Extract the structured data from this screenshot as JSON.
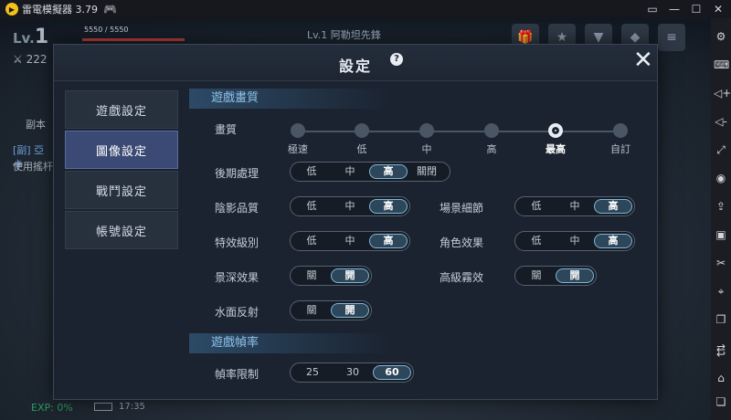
{
  "emulator": {
    "title": "雷電模擬器 3.79",
    "window_controls": [
      "▭",
      "—",
      "☐",
      "✕"
    ],
    "sidebar_tools": [
      "gear-icon",
      "keyboard-icon",
      "volume-up-icon",
      "volume-down-icon",
      "fullscreen-icon",
      "record-icon",
      "install-apk-icon",
      "screenshot-icon",
      "scissors-icon",
      "location-icon",
      "multi-window-icon",
      "sync-icon"
    ],
    "sidebar_bottom": [
      "back-icon",
      "home-icon",
      "recent-apps-icon"
    ]
  },
  "game_hud": {
    "level_prefix": "Lv.",
    "level": "1",
    "hp": "5550 / 5550",
    "target": "Lv.1  阿勒坦先鋒",
    "power": "222",
    "tab_dungeon": "副本",
    "quest_title": "[副] 亞卡",
    "quest_desc": "使用搖杆",
    "exp": "EXP: 0%",
    "time": "17:35"
  },
  "dialog": {
    "title": "設定",
    "help": "?",
    "close": "✕"
  },
  "nav": [
    {
      "label": "遊戲設定",
      "active": false
    },
    {
      "label": "圖像設定",
      "active": true
    },
    {
      "label": "戰鬥設定",
      "active": false
    },
    {
      "label": "帳號設定",
      "active": false
    }
  ],
  "graphics": {
    "section_title": "遊戲畫質",
    "quality": {
      "label": "畫質",
      "options": [
        "極速",
        "低",
        "中",
        "高",
        "最高",
        "自訂"
      ],
      "selected": "最高"
    },
    "post_processing": {
      "label": "後期處理",
      "options": [
        "低",
        "中",
        "高",
        "關閉"
      ],
      "selected": "高"
    },
    "shadow_quality": {
      "label": "陰影品質",
      "options": [
        "低",
        "中",
        "高"
      ],
      "selected": "高"
    },
    "scene_detail": {
      "label": "場景細節",
      "options": [
        "低",
        "中",
        "高"
      ],
      "selected": "高"
    },
    "effect_level": {
      "label": "特效級別",
      "options": [
        "低",
        "中",
        "高"
      ],
      "selected": "高"
    },
    "character_effect": {
      "label": "角色效果",
      "options": [
        "低",
        "中",
        "高"
      ],
      "selected": "高"
    },
    "depth_of_field": {
      "label": "景深效果",
      "options": [
        "關",
        "開"
      ],
      "selected": "開"
    },
    "advanced_fog": {
      "label": "高級霧效",
      "options": [
        "關",
        "開"
      ],
      "selected": "開"
    },
    "water_reflection": {
      "label": "水面反射",
      "options": [
        "關",
        "開"
      ],
      "selected": "開"
    }
  },
  "framerate": {
    "section_title": "遊戲幀率",
    "limit": {
      "label": "幀率限制",
      "options": [
        "25",
        "30",
        "60"
      ],
      "selected": "60"
    }
  }
}
